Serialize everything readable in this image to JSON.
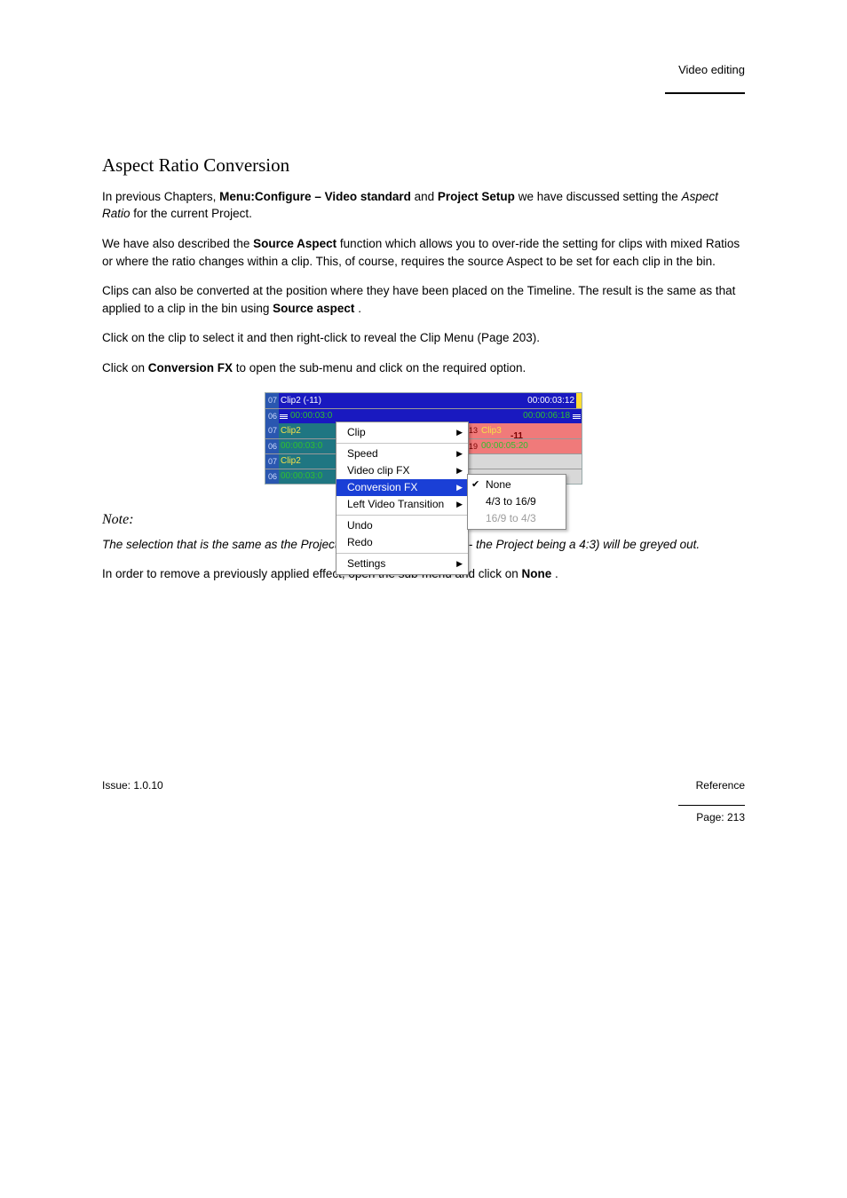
{
  "header": {
    "section": "Video editing"
  },
  "title": "Aspect Ratio Conversion",
  "p1_a": "In previous Chapters, ",
  "p1_b": "Menu:Configure – Video standard",
  "p1_c": " and ",
  "p1_d": "Project Setup",
  "p1_e": " we have discussed setting the ",
  "p1_f": "Aspect Ratio",
  "p1_g": " for the current Project.",
  "p2_a": "We have also described the ",
  "p2_b": "Source Aspect",
  "p2_c": " function which allows you to over-ride the setting for clips with mixed Ratios or where the ratio changes within a clip. This, of course, requires the source Aspect to be set for each clip in the bin.",
  "p3_a": "Clips can also be converted at the position where they have been placed on the Timeline. The result is the same as that applied to a clip in the bin using ",
  "p3_b": "Source aspect",
  "p3_c": ".",
  "p4": "Click on the clip to select it and then right-click to reveal the Clip Menu (Page 203).",
  "p5_a": "Click on ",
  "p5_b": "Conversion FX",
  "p5_c": " to open the sub-menu and click on the required option.",
  "note_title": "Note:",
  "note_body": "The selection that is the same as the Project (in this case 16:9 to 4/3 - the Project being a 4:3) will be greyed out.",
  "p6_a": "In order to remove a previously applied effect, open the sub-menu and click on ",
  "p6_b": "None",
  "p6_c": ".",
  "timeline": {
    "row1": {
      "num": "07",
      "label": "Clip2 (-11)",
      "right": "00:00:03:12"
    },
    "row2": {
      "num": "06",
      "label": "00:00:03:0",
      "right": "00:00:06:18"
    },
    "row3": {
      "num": "07",
      "label": "Clip2",
      "rnum": "13",
      "rlabel": "Clip3"
    },
    "row4": {
      "num": "06",
      "label": "00:00:03:0",
      "rnum": "19",
      "rtop": "-11",
      "rlabel": "00:00:05:20"
    },
    "row5": {
      "num": "07",
      "label": "Clip2"
    },
    "row6": {
      "num": "06",
      "label": "00:00:03:0"
    }
  },
  "menu": {
    "clip": "Clip",
    "speed": "Speed",
    "vfx": "Video clip FX",
    "conv": "Conversion FX",
    "lvt": "Left Video Transition",
    "undo": "Undo",
    "redo": "Redo",
    "settings": "Settings"
  },
  "submenu": {
    "none": "None",
    "a": "4/3 to 16/9",
    "b": "16/9 to 4/3"
  },
  "footer": {
    "left": "Issue: 1.0.10",
    "right_label": "Reference",
    "page": "Page: 213"
  }
}
